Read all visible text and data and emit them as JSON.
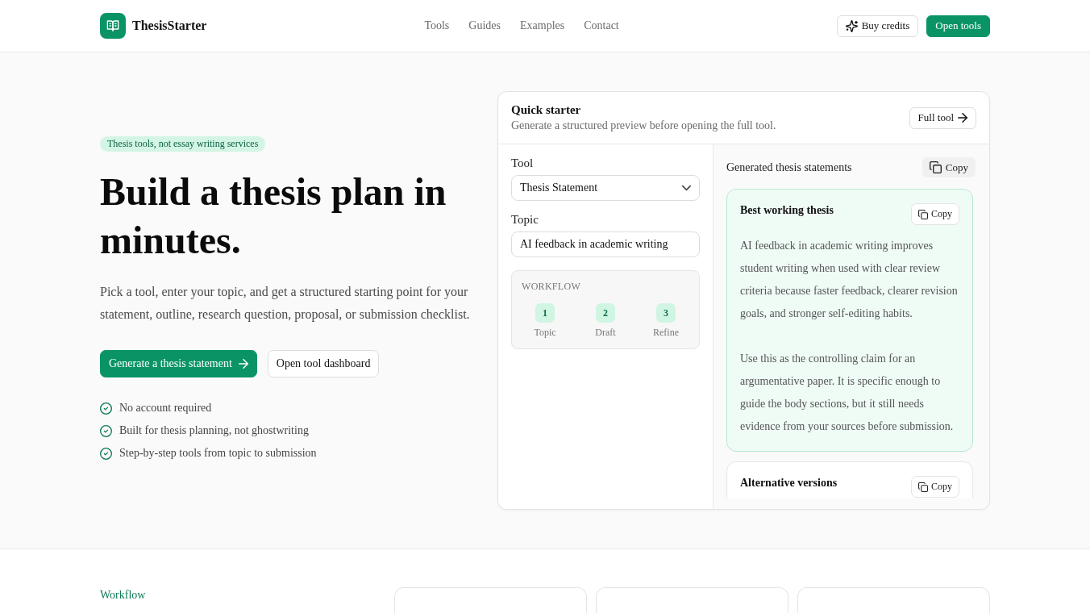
{
  "header": {
    "brand": "ThesisStarter",
    "nav": [
      "Tools",
      "Guides",
      "Examples",
      "Contact"
    ],
    "actions": [
      {
        "label": "Buy credits",
        "kind": "outline"
      },
      {
        "label": "Open tools",
        "kind": "primary"
      }
    ]
  },
  "hero": {
    "badge": "Thesis tools, not essay writing services",
    "title": "Build a thesis plan in minutes.",
    "lead": "Pick a tool, enter your topic, and get a structured starting point for your statement, outline, research question, proposal, or submission checklist.",
    "buttons": [
      {
        "label": "Generate a thesis statement",
        "kind": "primary"
      },
      {
        "label": "Open tool dashboard",
        "kind": "outline"
      }
    ],
    "points": [
      "No account required",
      "Built for thesis planning, not ghostwriting",
      "Step-by-step tools from topic to submission"
    ]
  },
  "quick_starter": {
    "title": "Quick starter",
    "subtitle": "Generate a structured preview before opening the full tool.",
    "link_button": "Full tool",
    "fields": [
      {
        "label": "Tool",
        "kind": "select",
        "value": "Thesis Statement"
      },
      {
        "label": "Topic",
        "kind": "text",
        "value": "AI feedback in academic writing"
      }
    ],
    "workflow": {
      "label": "WORKFLOW",
      "steps": [
        {
          "number": "1",
          "label": "Topic"
        },
        {
          "number": "2",
          "label": "Draft"
        },
        {
          "number": "3",
          "label": "Refine"
        }
      ]
    },
    "output": {
      "title": "Generated thesis statements",
      "copy_button": "Copy",
      "cards": [
        {
          "title": "Best working thesis",
          "copy_button": "Copy",
          "highlighted": true,
          "paragraphs": [
            "AI feedback in academic writing improves student writing when used with clear review criteria because faster feedback, clearer revision goals, and stronger self-editing habits.",
            "Use this as the controlling claim for an argumentative paper. It is specific enough to guide the body sections, but it still needs evidence from your sources before submission."
          ]
        },
        {
          "title": "Alternative versions",
          "copy_button": "Copy",
          "highlighted": false
        }
      ]
    }
  },
  "workflow_section": {
    "label": "Workflow"
  }
}
